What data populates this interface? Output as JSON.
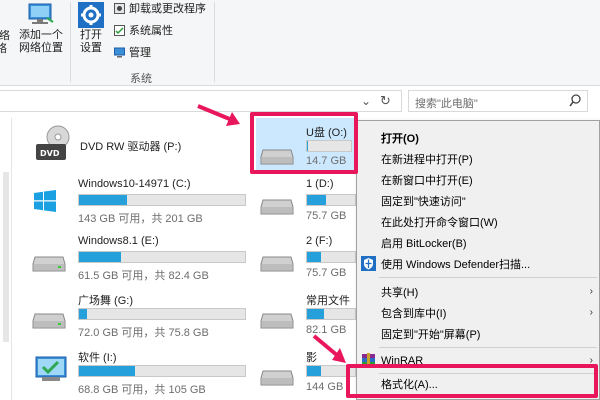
{
  "ribbon": {
    "network_partial_1": "网络",
    "network_partial_2": "络",
    "add_network_location": [
      "添加一个",
      "网络位置"
    ],
    "open_settings": [
      "打开",
      "设置"
    ],
    "uninstall_program": "卸载或更改程序",
    "system_properties": "系统属性",
    "manage": "管理",
    "group_system": "系统"
  },
  "search": {
    "placeholder": "搜索\"此电脑\""
  },
  "drives": [
    {
      "name": "DVD RW 驱动器 (P:)",
      "size_text": ""
    },
    {
      "name": "Windows10-14971 (C:)",
      "size_text": "143 GB 可用，共 201 GB",
      "used_fraction": 0.29
    },
    {
      "name": "Windows8.1 (E:)",
      "size_text": "61.5 GB 可用，共 82.4 GB",
      "used_fraction": 0.25
    },
    {
      "name": "广场舞 (G:)",
      "size_text": "72.0 GB 可用，共 75.8 GB",
      "used_fraction": 0.05
    },
    {
      "name": "软件 (I:)",
      "size_text": "68.8 GB 可用，共 105 GB",
      "used_fraction": 0.34
    },
    {
      "name": "U盘 (O:)",
      "size_text": "14.7 GB",
      "used_fraction": 0.02
    },
    {
      "name": "1 (D:)",
      "size_text": "75.7 GB",
      "used_fraction": 0.4
    },
    {
      "name": "2 (F:)",
      "size_text": "75.7 GB",
      "used_fraction": 0.3
    },
    {
      "name": "常用文件",
      "size_text": "82.1 GB",
      "used_fraction": 0.35
    },
    {
      "name": "影",
      "size_text": "144 GB",
      "used_fraction": 0.3
    }
  ],
  "context_menu": {
    "items": [
      "打开(O)",
      "在新进程中打开(P)",
      "在新窗口中打开(E)",
      "固定到\"快速访问\"",
      "在此处打开命令窗口(W)",
      "启用 BitLocker(B)",
      "使用 Windows Defender扫描...",
      "共享(H)",
      "包含到库中(I)",
      "固定到\"开始\"屏幕(P)",
      "WinRAR",
      "格式化(A)..."
    ]
  },
  "colors": {
    "highlight": "#e8165b",
    "accent": "#26a0da"
  }
}
